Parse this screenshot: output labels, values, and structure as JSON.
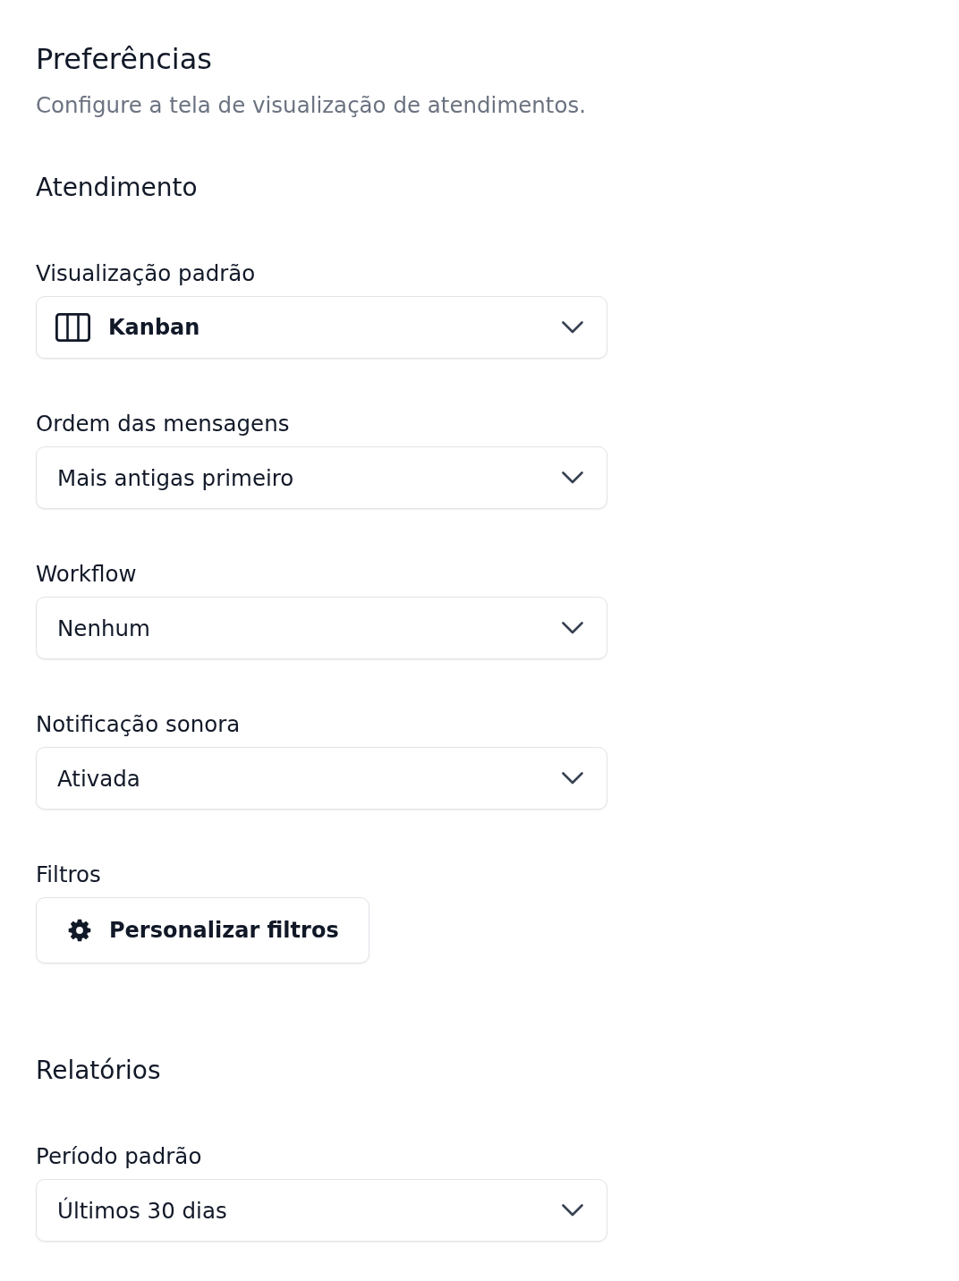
{
  "page": {
    "title": "Preferências",
    "subtitle": "Configure a tela de visualização de atendimentos."
  },
  "sections": [
    {
      "heading": "Atendimento",
      "fields": [
        {
          "kind": "icon-select",
          "label": "Visualização padrão",
          "value": "Kanban"
        },
        {
          "kind": "select",
          "label": "Ordem das mensagens",
          "value": "Mais antigas primeiro"
        },
        {
          "kind": "select",
          "label": "Workflow",
          "value": "Nenhum"
        },
        {
          "kind": "select",
          "label": "Notificação sonora",
          "value": "Ativada"
        },
        {
          "kind": "button",
          "label": "Filtros",
          "button": "Personalizar filtros"
        }
      ]
    },
    {
      "heading": "Relatórios",
      "fields": [
        {
          "kind": "select",
          "label": "Período padrão",
          "value": "Últimos 30 dias"
        }
      ]
    }
  ]
}
